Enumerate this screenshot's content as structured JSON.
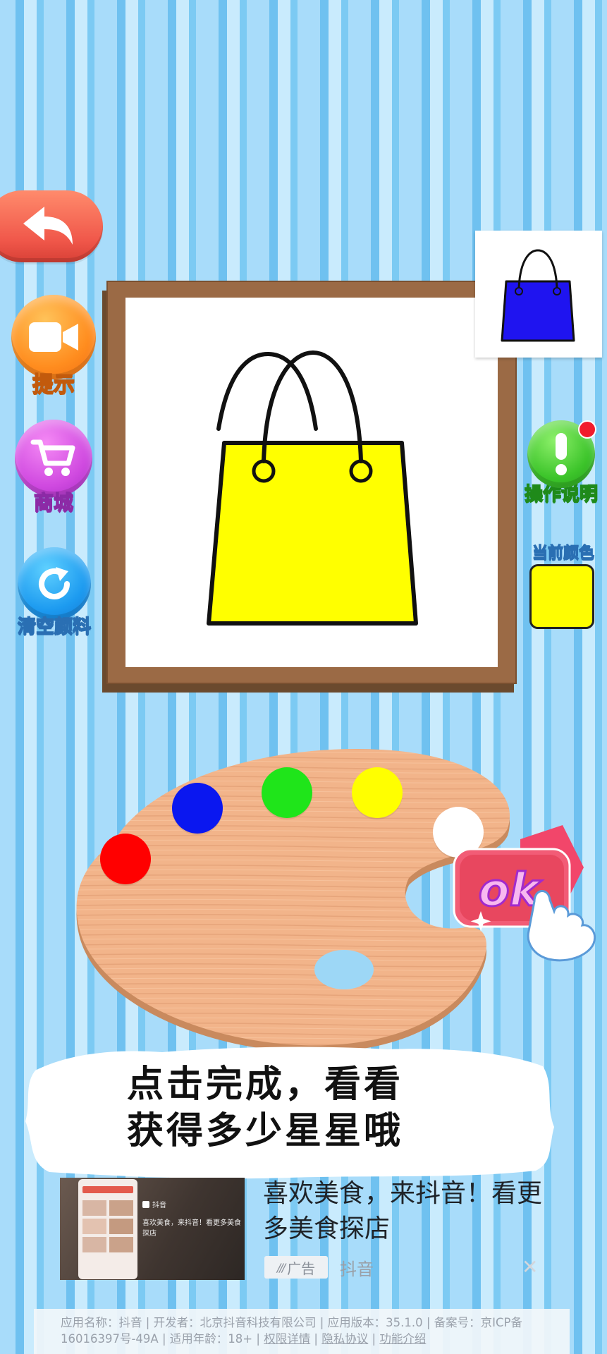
{
  "game": {
    "hint_label": "提示",
    "shop_label": "商城",
    "clear_label": "清空颜料",
    "help_label": "操作说明",
    "current_color_label": "当前颜色",
    "current_color": "#ffff00",
    "target_bag_color": "#1f14f0",
    "painted_bag_color": "#ffff00",
    "paints": [
      {
        "name": "red",
        "color": "#ff0000"
      },
      {
        "name": "blue",
        "color": "#0a17f0"
      },
      {
        "name": "green",
        "color": "#1fe51a"
      },
      {
        "name": "yellow",
        "color": "#ffff00"
      },
      {
        "name": "white",
        "color": "#ffffff"
      }
    ],
    "ok_label": "ok",
    "banner_line1": "点击完成，看看",
    "banner_line2": "获得多少星星哦"
  },
  "ad": {
    "title": "喜欢美食，来抖音！看更多美食探店",
    "badge": "广告",
    "source": "抖音",
    "close": "✕",
    "card_brand": "抖音",
    "card_text": "喜欢美食，来抖音！看更多美食探店"
  },
  "footer": {
    "app_name": "应用名称：抖音",
    "developer": "开发者：北京抖音科技有限公司",
    "version": "应用版本：35.1.0",
    "record": "备案号：京ICP备16016397号-49A",
    "age": "适用年龄：18+",
    "permissions": "权限详情",
    "privacy": "隐私协议",
    "features": "功能介绍"
  }
}
